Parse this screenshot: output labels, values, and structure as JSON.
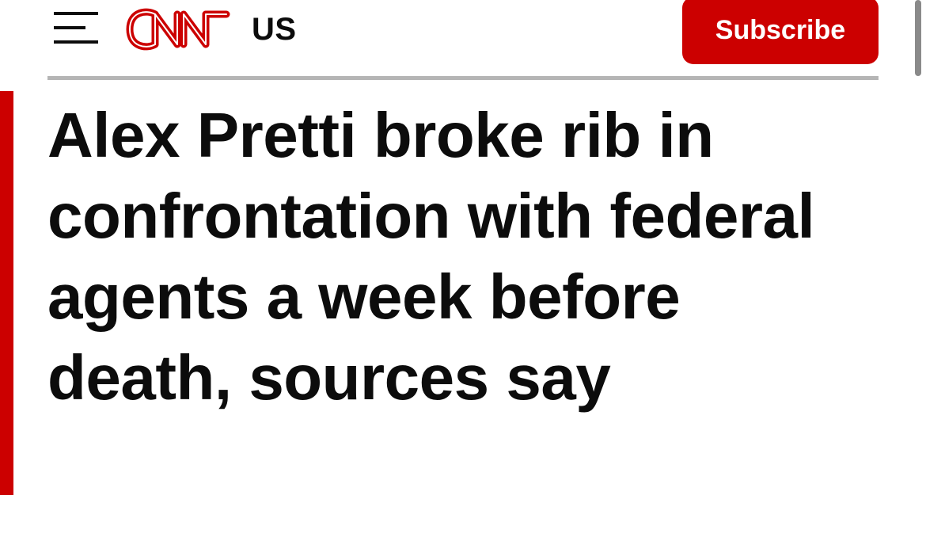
{
  "header": {
    "logo_text": "CNN",
    "section_label": "US",
    "subscribe_label": "Subscribe"
  },
  "icons": {
    "menu": "hamburger-menu-icon",
    "logo": "cnn-logo"
  },
  "article": {
    "headline": "Alex Pretti broke rib in confrontation with federal agents a week before death, sources say"
  },
  "colors": {
    "brand_red": "#cc0000",
    "text": "#0c0c0c",
    "divider": "#b5b5b5",
    "background": "#ffffff"
  }
}
